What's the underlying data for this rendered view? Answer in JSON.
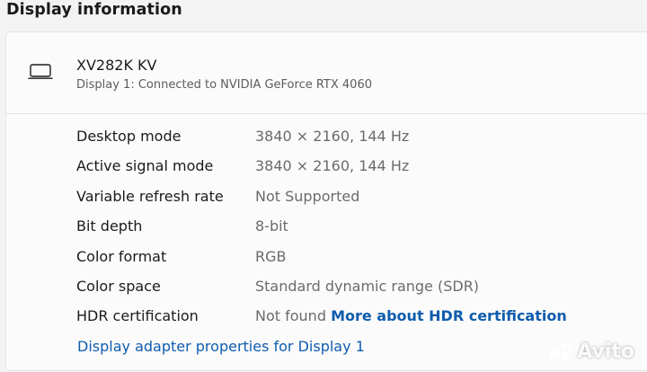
{
  "section": {
    "title": "Display information"
  },
  "display": {
    "name": "XV282K KV",
    "subtitle": "Display 1: Connected to NVIDIA GeForce RTX 4060",
    "icon": "monitor-icon"
  },
  "rows": [
    {
      "label": "Desktop mode",
      "value": "3840 × 2160, 144 Hz"
    },
    {
      "label": "Active signal mode",
      "value": "3840 × 2160, 144 Hz"
    },
    {
      "label": "Variable refresh rate",
      "value": "Not Supported"
    },
    {
      "label": "Bit depth",
      "value": "8-bit"
    },
    {
      "label": "Color format",
      "value": "RGB"
    },
    {
      "label": "Color space",
      "value": "Standard dynamic range (SDR)"
    },
    {
      "label": "HDR certification",
      "value": "Not found",
      "link": "More about HDR certification"
    }
  ],
  "adapter_link": "Display adapter properties for Display 1",
  "watermark": {
    "text": "Avito"
  },
  "colors": {
    "link": "#0f5cad",
    "background": "#f3f3f3",
    "card": "#fbfbfb"
  }
}
